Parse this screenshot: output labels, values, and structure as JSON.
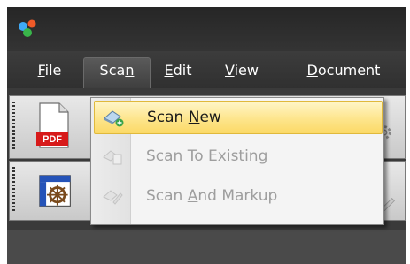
{
  "menubar": {
    "items": [
      {
        "label": "File",
        "key_index": 0
      },
      {
        "label": "Scan",
        "key_index": 3,
        "active": true
      },
      {
        "label": "Edit",
        "key_index": 0
      },
      {
        "label": "View",
        "key_index": 0
      },
      {
        "label": "Document",
        "key_index": 0
      }
    ]
  },
  "toolbar": {
    "pdf_badge": "PDF"
  },
  "scan_menu": {
    "items": [
      {
        "label": "Scan New",
        "key_index": 5,
        "enabled": true,
        "highlighted": true,
        "icon": "scanner-add-icon"
      },
      {
        "label": "Scan To Existing",
        "key_index": 5,
        "enabled": false,
        "icon": "scan-to-existing-icon"
      },
      {
        "label": "Scan And Markup",
        "key_index": 5,
        "enabled": false,
        "icon": "scan-markup-icon"
      }
    ]
  },
  "colors": {
    "menubar_bg": "#343434",
    "highlight": "#fde58c",
    "disabled_text": "#9e9e9e",
    "pdf_red": "#d71a1a"
  }
}
